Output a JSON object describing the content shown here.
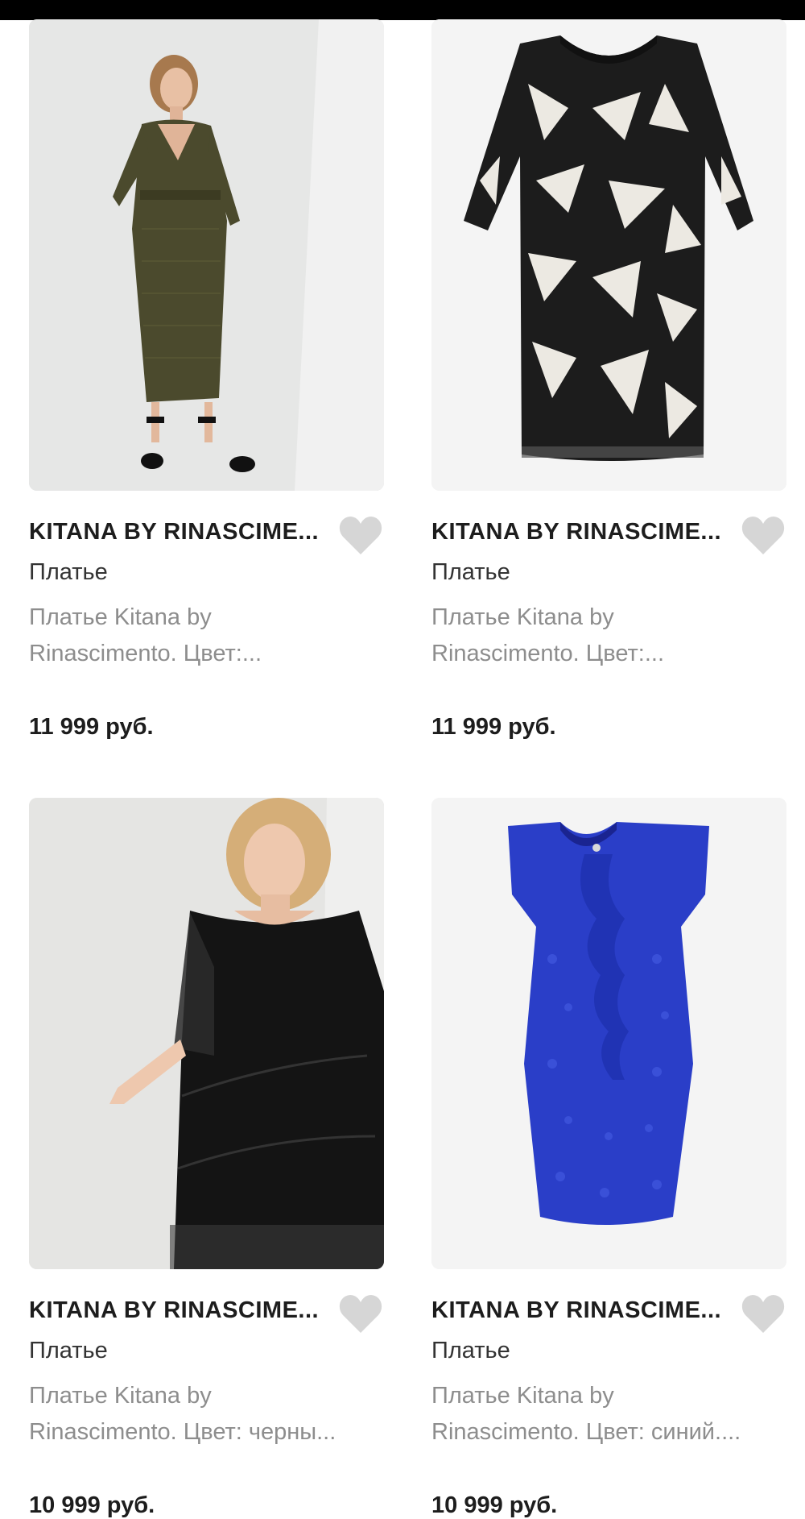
{
  "products": [
    {
      "brand": "KITANA BY RINASCIME...",
      "category": "Платье",
      "desc_line1": "Платье Kitana by",
      "desc_line2": "Rinascimento. Цвет:...",
      "price": "11 999 руб.",
      "image_icon": "olive-wrap-dress-photo"
    },
    {
      "brand": "KITANA BY RINASCIME...",
      "category": "Платье",
      "desc_line1": "Платье Kitana by",
      "desc_line2": "Rinascimento. Цвет:...",
      "price": "11 999 руб.",
      "image_icon": "black-white-print-dress-photo"
    },
    {
      "brand": "KITANA BY RINASCIME...",
      "category": "Платье",
      "desc_line1": "Платье Kitana by",
      "desc_line2": "Rinascimento. Цвет: черны...",
      "price": "10 999 руб.",
      "image_icon": "black-layered-dress-photo"
    },
    {
      "brand": "KITANA BY RINASCIME...",
      "category": "Платье",
      "desc_line1": "Платье Kitana by",
      "desc_line2": "Rinascimento. Цвет: синий....",
      "price": "10 999 руб.",
      "image_icon": "blue-lace-dress-photo"
    }
  ],
  "colors": {
    "heart_icon": "#d6d6d6",
    "brand_text": "#1d1d1d",
    "desc_text": "#8d8d8d"
  }
}
